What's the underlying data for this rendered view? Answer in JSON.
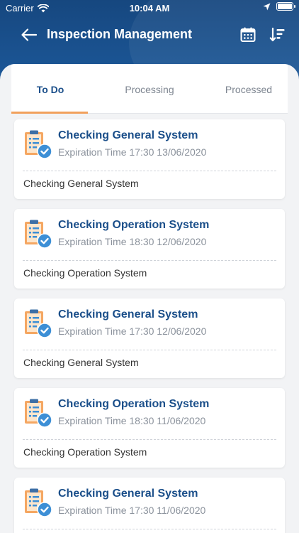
{
  "status_bar": {
    "carrier": "Carrier",
    "time": "10:04 AM"
  },
  "nav": {
    "title": "Inspection Management"
  },
  "tabs": [
    {
      "label": "To Do",
      "active": true
    },
    {
      "label": "Processing",
      "active": false
    },
    {
      "label": "Processed",
      "active": false
    }
  ],
  "tasks": [
    {
      "title": "Checking General System",
      "expiration": "Expiration Time 17:30 13/06/2020",
      "description": "Checking General System"
    },
    {
      "title": "Checking Operation System",
      "expiration": "Expiration Time 18:30 12/06/2020",
      "description": "Checking Operation System"
    },
    {
      "title": "Checking General System",
      "expiration": "Expiration Time 17:30 12/06/2020",
      "description": "Checking General System"
    },
    {
      "title": "Checking Operation System",
      "expiration": "Expiration Time 18:30 11/06/2020",
      "description": "Checking Operation System"
    },
    {
      "title": "Checking General System",
      "expiration": "Expiration Time 17:30 11/06/2020",
      "description": ""
    }
  ],
  "colors": {
    "header": "#1a4f8a",
    "accent": "#f1a05c",
    "title_text": "#1b4f8a",
    "check_badge": "#3d8fd6"
  },
  "icons": {
    "back": "arrow-left-icon",
    "calendar": "calendar-icon",
    "sort": "sort-filter-icon",
    "task": "clipboard-check-icon"
  }
}
